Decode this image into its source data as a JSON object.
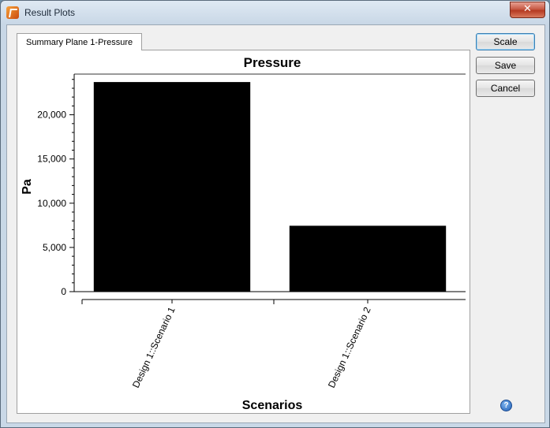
{
  "window": {
    "title": "Result Plots",
    "close_glyph": "✕"
  },
  "tab": {
    "label": "Summary Plane 1-Pressure"
  },
  "buttons": {
    "scale": "Scale",
    "save": "Save",
    "cancel": "Cancel"
  },
  "help": {
    "glyph": "?"
  },
  "chart_data": {
    "type": "bar",
    "title": "Pressure",
    "xlabel": "Scenarios",
    "ylabel": "Pa",
    "categories": [
      "Design 1::Scenario 1",
      "Design 1::Scenario 2"
    ],
    "values": [
      23700,
      7450
    ],
    "ylim": [
      0,
      24600
    ],
    "yticks": [
      0,
      5000,
      10000,
      15000,
      20000
    ],
    "ytick_labels": [
      "0",
      "5,000",
      "10,000",
      "15,000",
      "20,000"
    ],
    "bar_color": "#000000",
    "grid": false,
    "legend": "none"
  }
}
